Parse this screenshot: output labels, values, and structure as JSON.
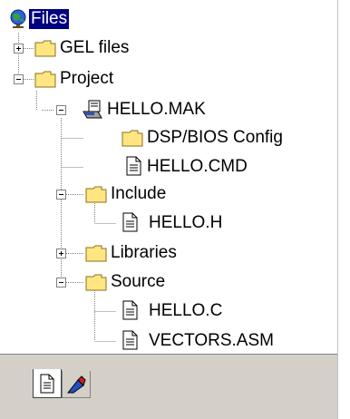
{
  "tree": {
    "root": "Files",
    "gel_files": "GEL files",
    "project": "Project",
    "hello_mak": "HELLO.MAK",
    "dsp_bios": "DSP/BIOS Config",
    "hello_cmd": "HELLO.CMD",
    "include": "Include",
    "hello_h": "HELLO.H",
    "libraries": "Libraries",
    "source": "Source",
    "hello_c": "HELLO.C",
    "vectors_asm": "VECTORS.ASM"
  },
  "icons": {
    "root": "globe-icon",
    "folder": "folder-icon",
    "project_file": "project-file-icon",
    "document": "document-icon",
    "file_view_tab": "file-view-tab-icon",
    "bookmarks_tab": "bookmarks-tab-icon"
  },
  "colors": {
    "selection": "#000080",
    "folder": "#ffe680",
    "panel": "#d4d0c8"
  }
}
